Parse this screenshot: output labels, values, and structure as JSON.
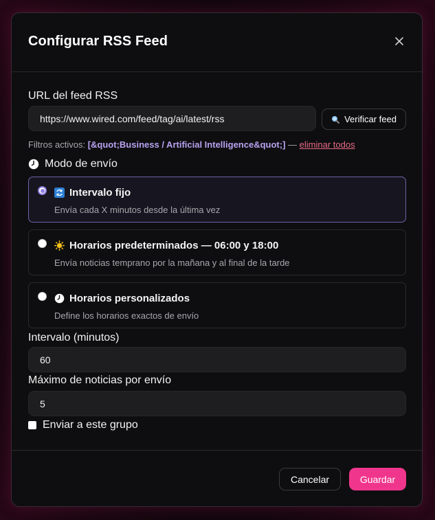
{
  "dialog": {
    "title": "Configurar RSS Feed",
    "close_icon": "close-icon"
  },
  "feed": {
    "label": "URL del feed RSS",
    "url": "https://www.wired.com/feed/tag/ai/latest/rss",
    "verify_icon": "magnifier-icon",
    "verify_label": "Verificar feed"
  },
  "filters": {
    "prefix": "Filtros activos:",
    "tags": "[&quot;Business / Artificial Intelligence&quot;]",
    "separator": "—",
    "remove_all": "eliminar todos"
  },
  "mode": {
    "icon": "clock-icon",
    "label": "Modo de envío",
    "options": [
      {
        "icon": "refresh-icon",
        "title": "Intervalo fijo",
        "description": "Envía cada X minutos desde la última vez",
        "selected": true
      },
      {
        "icon": "sun-icon",
        "title": "Horarios predeterminados — 06:00 y 18:00",
        "description": "Envía noticias temprano por la mañana y al final de la tarde",
        "selected": false
      },
      {
        "icon": "clock-icon",
        "title": "Horarios personalizados",
        "description": "Define los horarios exactos de envío",
        "selected": false
      }
    ]
  },
  "interval": {
    "label": "Intervalo (minutos)",
    "value": "60"
  },
  "max_news": {
    "label": "Máximo de noticias por envío",
    "value": "5"
  },
  "group": {
    "label": "Enviar a este grupo",
    "checked": false
  },
  "footer": {
    "cancel_label": "Cancelar",
    "save_label": "Guardar"
  },
  "colors": {
    "accent": "#f0368c",
    "selected_border": "#6e63a8",
    "link": "#e86a86",
    "tag": "#b9a2f0"
  }
}
